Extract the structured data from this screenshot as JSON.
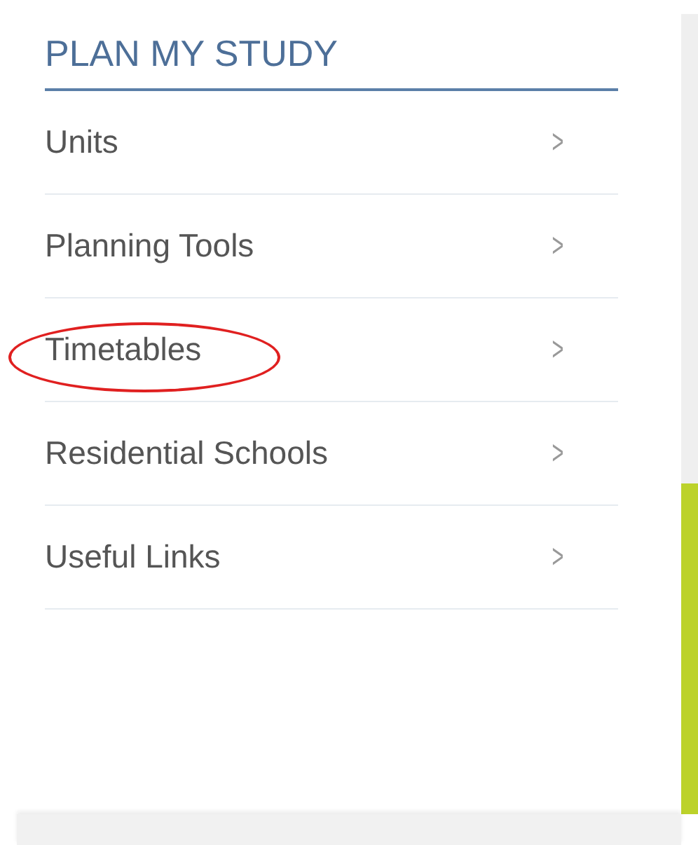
{
  "heading": "PLAN MY STUDY",
  "items": [
    {
      "label": "Units",
      "chevron": ">",
      "circled": false
    },
    {
      "label": "Planning Tools",
      "chevron": ">",
      "circled": false
    },
    {
      "label": "Timetables",
      "chevron": ">",
      "circled": true
    },
    {
      "label": "Residential Schools",
      "chevron": ">",
      "circled": false
    },
    {
      "label": "Useful Links",
      "chevron": ">",
      "circled": false
    }
  ]
}
